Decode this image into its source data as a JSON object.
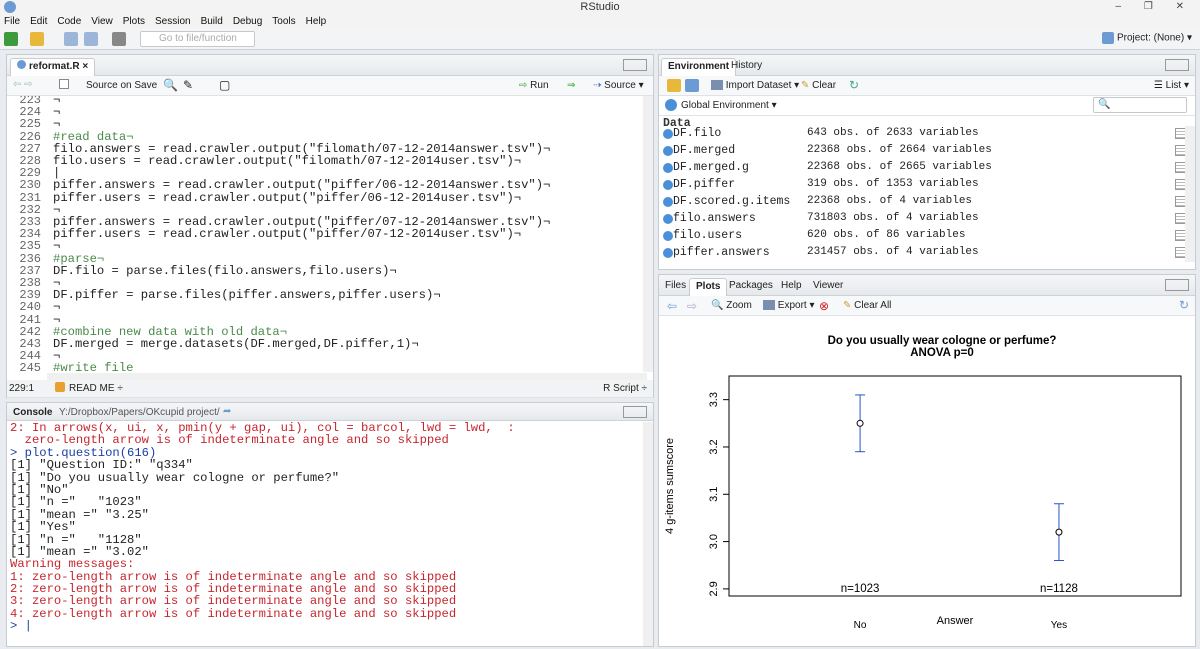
{
  "app": {
    "title": "RStudio",
    "window_controls": "– ❐ ✕"
  },
  "menu": [
    "File",
    "Edit",
    "Code",
    "View",
    "Plots",
    "Session",
    "Build",
    "Debug",
    "Tools",
    "Help"
  ],
  "toolbar": {
    "goto_placeholder": "Go to file/function",
    "project": "Project: (None) ▾"
  },
  "editor": {
    "tab": "reformat.R ×",
    "source_on_save": "Source on Save",
    "run": "Run",
    "source": "Source ▾",
    "lines": [
      {
        "n": "223",
        "t": "¬"
      },
      {
        "n": "224",
        "t": "¬"
      },
      {
        "n": "225",
        "t": "¬"
      },
      {
        "n": "226",
        "t": "#read data¬"
      },
      {
        "n": "227",
        "t": "filo.answers = read.crawler.output(\"filomath/07-12-2014answer.tsv\")¬"
      },
      {
        "n": "228",
        "t": "filo.users = read.crawler.output(\"filomath/07-12-2014user.tsv\")¬"
      },
      {
        "n": "229",
        "t": "|"
      },
      {
        "n": "230",
        "t": "piffer.answers = read.crawler.output(\"piffer/06-12-2014answer.tsv\")¬"
      },
      {
        "n": "231",
        "t": "piffer.users = read.crawler.output(\"piffer/06-12-2014user.tsv\")¬"
      },
      {
        "n": "232",
        "t": "¬"
      },
      {
        "n": "233",
        "t": "piffer.answers = read.crawler.output(\"piffer/07-12-2014answer.tsv\")¬"
      },
      {
        "n": "234",
        "t": "piffer.users = read.crawler.output(\"piffer/07-12-2014user.tsv\")¬"
      },
      {
        "n": "235",
        "t": "¬"
      },
      {
        "n": "236",
        "t": "#parse¬"
      },
      {
        "n": "237",
        "t": "DF.filo = parse.files(filo.answers,filo.users)¬"
      },
      {
        "n": "238",
        "t": "¬"
      },
      {
        "n": "239",
        "t": "DF.piffer = parse.files(piffer.answers,piffer.users)¬"
      },
      {
        "n": "240",
        "t": "¬"
      },
      {
        "n": "241",
        "t": "¬"
      },
      {
        "n": "242",
        "t": "#combine new data with old data¬"
      },
      {
        "n": "243",
        "t": "DF.merged = merge.datasets(DF.merged,DF.piffer,1)¬"
      },
      {
        "n": "244",
        "t": "¬"
      },
      {
        "n": "245",
        "t": "#write file"
      }
    ],
    "status_pos": "229:1",
    "status_scope": "READ ME ÷",
    "status_type": "R Script ÷"
  },
  "console": {
    "title": "Console",
    "path": "Y:/Dropbox/Papers/OKcupid project/",
    "lines": [
      {
        "c": "red",
        "t": "2: In arrows(x, ui, x, pmin(y + gap, ui), col = barcol, lwd = lwd,  :"
      },
      {
        "c": "red",
        "t": "  zero-length arrow is of indeterminate angle and so skipped"
      },
      {
        "c": "blue",
        "t": "> plot.question(616)"
      },
      {
        "c": "blk",
        "t": "[1] \"Question ID:\" \"q334\""
      },
      {
        "c": "blk",
        "t": "[1] \"Do you usually wear cologne or perfume?\""
      },
      {
        "c": "blk",
        "t": "[1] \"No\""
      },
      {
        "c": "blk",
        "t": "[1] \"n =\"   \"1023\""
      },
      {
        "c": "blk",
        "t": "[1] \"mean =\" \"3.25\""
      },
      {
        "c": "blk",
        "t": "[1] \"Yes\""
      },
      {
        "c": "blk",
        "t": "[1] \"n =\"   \"1128\""
      },
      {
        "c": "blk",
        "t": "[1] \"mean =\" \"3.02\""
      },
      {
        "c": "red",
        "t": "Warning messages:"
      },
      {
        "c": "red",
        "t": "1: zero-length arrow is of indeterminate angle and so skipped"
      },
      {
        "c": "red",
        "t": "2: zero-length arrow is of indeterminate angle and so skipped"
      },
      {
        "c": "red",
        "t": "3: zero-length arrow is of indeterminate angle and so skipped"
      },
      {
        "c": "red",
        "t": "4: zero-length arrow is of indeterminate angle and so skipped"
      },
      {
        "c": "blue",
        "t": "> |"
      }
    ]
  },
  "env": {
    "tabs": [
      "Environment",
      "History"
    ],
    "import": "Import Dataset ▾",
    "clear": "Clear",
    "list": "List ▾",
    "global": "Global Environment ▾",
    "section": "Data",
    "rows": [
      {
        "name": "DF.filo",
        "value": "643 obs. of 2633 variables"
      },
      {
        "name": "DF.merged",
        "value": "22368 obs. of 2664 variables"
      },
      {
        "name": "DF.merged.g",
        "value": "22368 obs. of 2665 variables"
      },
      {
        "name": "DF.piffer",
        "value": "319 obs. of 1353 variables"
      },
      {
        "name": "DF.scored.g.items",
        "value": "22368 obs. of 4 variables"
      },
      {
        "name": "filo.answers",
        "value": "731803 obs. of 4 variables"
      },
      {
        "name": "filo.users",
        "value": "620 obs. of 86 variables"
      },
      {
        "name": "piffer.answers",
        "value": "231457 obs. of 4 variables"
      }
    ]
  },
  "plots": {
    "tabs": [
      "Files",
      "Plots",
      "Packages",
      "Help",
      "Viewer"
    ],
    "zoom": "Zoom",
    "export": "Export ▾",
    "clear_all": "Clear All"
  },
  "chart_data": {
    "type": "scatter",
    "title": "Do you usually wear cologne or perfume?",
    "subtitle": "ANOVA p=0",
    "xlabel": "Answer",
    "ylabel": "4 g-items sumscore",
    "categories": [
      "No",
      "Yes"
    ],
    "means": [
      3.25,
      3.02
    ],
    "ci_low": [
      3.19,
      2.96
    ],
    "ci_high": [
      3.31,
      3.08
    ],
    "n_labels": [
      "n=1023",
      "n=1128"
    ],
    "yticks": [
      "2.9",
      "3.0",
      "3.1",
      "3.2",
      "3.3"
    ],
    "ylim": [
      2.885,
      3.35
    ],
    "color": "#2255cc"
  }
}
